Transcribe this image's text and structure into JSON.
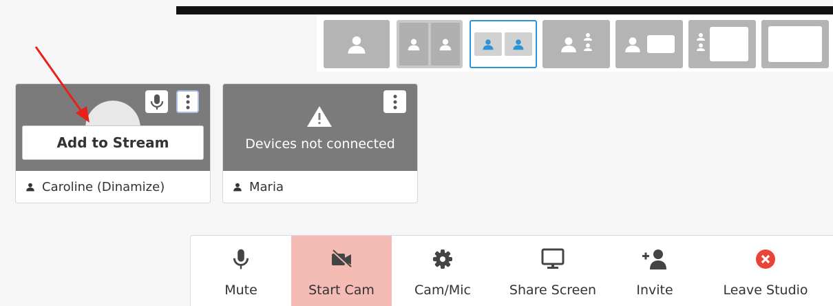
{
  "layout_options": [
    {
      "name": "solo",
      "selected": false
    },
    {
      "name": "split-gray",
      "selected": false
    },
    {
      "name": "split-blue",
      "selected": true
    },
    {
      "name": "one-plus-stack",
      "selected": false
    },
    {
      "name": "one-plus-screen",
      "selected": false
    },
    {
      "name": "stack-plus-screen",
      "selected": false
    },
    {
      "name": "screen-only",
      "selected": false
    }
  ],
  "participants": [
    {
      "name": "Caroline (Dinamize)",
      "action_label": "Add to Stream"
    },
    {
      "name": "Maria",
      "status": "Devices not connected"
    }
  ],
  "toolbar": {
    "mute": "Mute",
    "start_cam": "Start Cam",
    "cam_mic": "Cam/Mic",
    "share_screen": "Share Screen",
    "invite": "Invite",
    "leave_studio": "Leave Studio"
  },
  "colors": {
    "accent_blue": "#2b93d6",
    "active_button": "#f5bcb6",
    "leave_red": "#e8443a",
    "annotation_arrow": "#e8201b"
  }
}
